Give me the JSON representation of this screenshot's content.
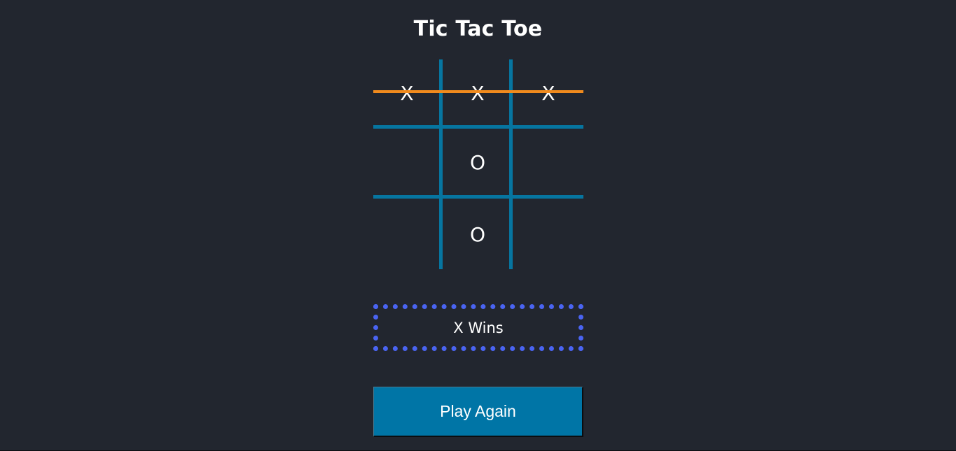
{
  "title": "Tic Tac Toe",
  "board": {
    "cells": [
      "X",
      "X",
      "X",
      "",
      "O",
      "",
      "",
      "O",
      ""
    ],
    "winning_row": "top",
    "colors": {
      "grid": "#0675a0",
      "win_line": "#f08a1d"
    }
  },
  "status": {
    "text": "X Wins",
    "border_color": "#4a64f2"
  },
  "play_again": {
    "label": "Play Again",
    "color": "#0075a6"
  },
  "background_color": "#22262f"
}
